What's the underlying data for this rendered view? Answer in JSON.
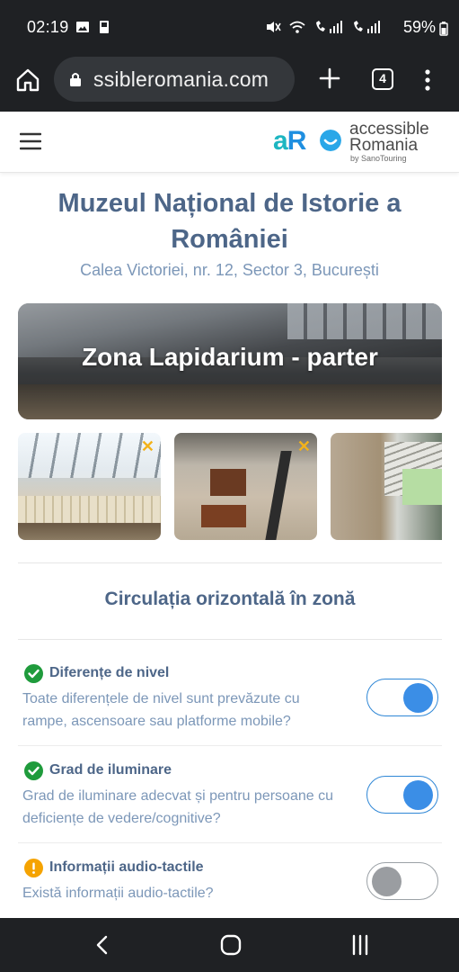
{
  "status_bar": {
    "time": "02:19",
    "battery": "59%",
    "icons_left": [
      "image-icon",
      "storage-icon"
    ],
    "icons_right": [
      "mute-icon",
      "wifi-calling-icon",
      "call-signal-1-icon",
      "call-signal-2-icon"
    ]
  },
  "browser": {
    "url": "ssibleromania.com",
    "tab_count": "4"
  },
  "header": {
    "logo_mark": "aR",
    "logo_line1": "accessible",
    "logo_line2": "Romania",
    "logo_line3": "by SanoTouring"
  },
  "page": {
    "title": "Muzeul Național de Istorie a României",
    "address": "Calea Victoriei, nr. 12, Sector 3, București"
  },
  "hero": {
    "title": "Zona Lapidarium - parter"
  },
  "section": {
    "title": "Circulația orizontală în zonă"
  },
  "criteria": [
    {
      "label": "Diferențe de nivel",
      "description": "Toate diferențele de nivel sunt prevăzute cu rampe, ascensoare sau platforme mobile?",
      "status": "ok",
      "enabled": true
    },
    {
      "label": "Grad de iluminare",
      "description": "Grad de iluminare adecvat și pentru persoane cu deficiențe de vedere/cognitive?",
      "status": "ok",
      "enabled": true
    },
    {
      "label": "Informații audio-tactile",
      "description": "Există informații audio-tactile?",
      "status": "warning",
      "enabled": false
    }
  ],
  "colors": {
    "heading": "#4d6688",
    "subtext": "#7c97b8",
    "ok": "#1f9b3c",
    "warning": "#f5a301",
    "toggle_on": "#3b8ee6",
    "system_bar": "#1f2124"
  }
}
